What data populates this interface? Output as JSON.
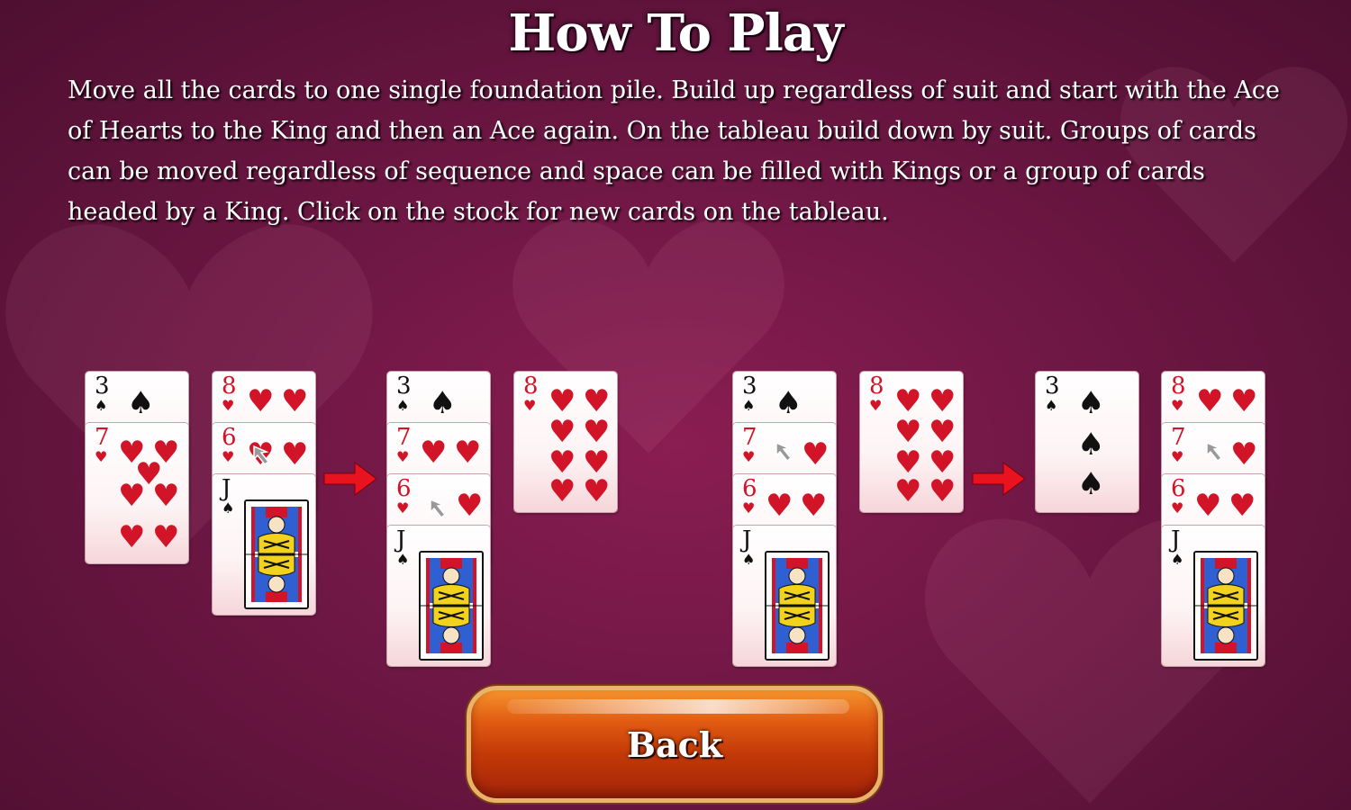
{
  "title": "How To Play",
  "instructions": "Move all the cards to one single foundation pile. Build up regardless of suit and start with the Ace of Hearts to the King and then an Ace again. On the tableau build down by suit. Groups of cards can be moved regardless of sequence and space can be filled with Kings or a group of cards headed by a King. Click on the stock for new cards on the tableau.",
  "back_label": "Back",
  "suits": {
    "spade": "♠",
    "heart": "♥"
  },
  "colors": {
    "red": "#d11428",
    "arrow": "#e8131f",
    "button": "#c23908"
  },
  "examples": [
    {
      "before": [
        [
          "3♠",
          "7♥"
        ],
        [
          "8♥",
          "6♥",
          "J♠"
        ]
      ],
      "after": [
        [
          "3♠",
          "7♥",
          "6♥",
          "J♠"
        ],
        [
          "8♥"
        ]
      ]
    },
    {
      "before": [
        [
          "3♠",
          "7♥",
          "6♥",
          "J♠"
        ],
        [
          "8♥"
        ]
      ],
      "after": [
        [
          "3♠"
        ],
        [
          "8♥",
          "7♥",
          "6♥",
          "J♠"
        ]
      ]
    }
  ],
  "cards": {
    "c1": {
      "rank": "3",
      "suit": "♠"
    },
    "c2": {
      "rank": "7",
      "suit": "♥"
    },
    "c3": {
      "rank": "8",
      "suit": "♥"
    },
    "c4": {
      "rank": "6",
      "suit": "♥"
    },
    "c5": {
      "rank": "J",
      "suit": "♠"
    },
    "c6": {
      "rank": "3",
      "suit": "♠"
    },
    "c7": {
      "rank": "7",
      "suit": "♥"
    },
    "c8": {
      "rank": "6",
      "suit": "♥"
    },
    "c9": {
      "rank": "J",
      "suit": "♠"
    },
    "c10": {
      "rank": "8",
      "suit": "♥"
    },
    "c11": {
      "rank": "3",
      "suit": "♠"
    },
    "c12": {
      "rank": "7",
      "suit": "♥"
    },
    "c13": {
      "rank": "6",
      "suit": "♥"
    },
    "c14": {
      "rank": "J",
      "suit": "♠"
    },
    "c15": {
      "rank": "8",
      "suit": "♥"
    },
    "c16": {
      "rank": "3",
      "suit": "♠"
    },
    "c17": {
      "rank": "8",
      "suit": "♥"
    },
    "c18": {
      "rank": "7",
      "suit": "♥"
    },
    "c19": {
      "rank": "6",
      "suit": "♥"
    },
    "c20": {
      "rank": "J",
      "suit": "♠"
    }
  }
}
